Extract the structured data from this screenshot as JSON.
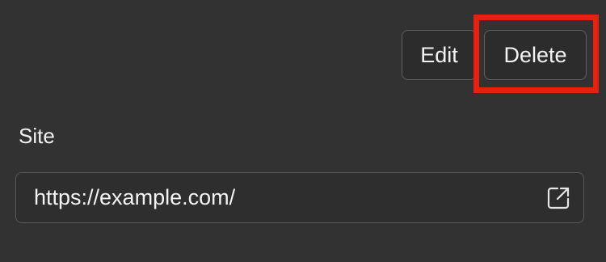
{
  "toolbar": {
    "edit_label": "Edit",
    "delete_label": "Delete"
  },
  "site": {
    "label": "Site",
    "url": "https://example.com/",
    "open_icon": "external-link-icon"
  },
  "colors": {
    "background": "#323232",
    "highlight": "#e8210f",
    "text": "#f2f2f2"
  }
}
